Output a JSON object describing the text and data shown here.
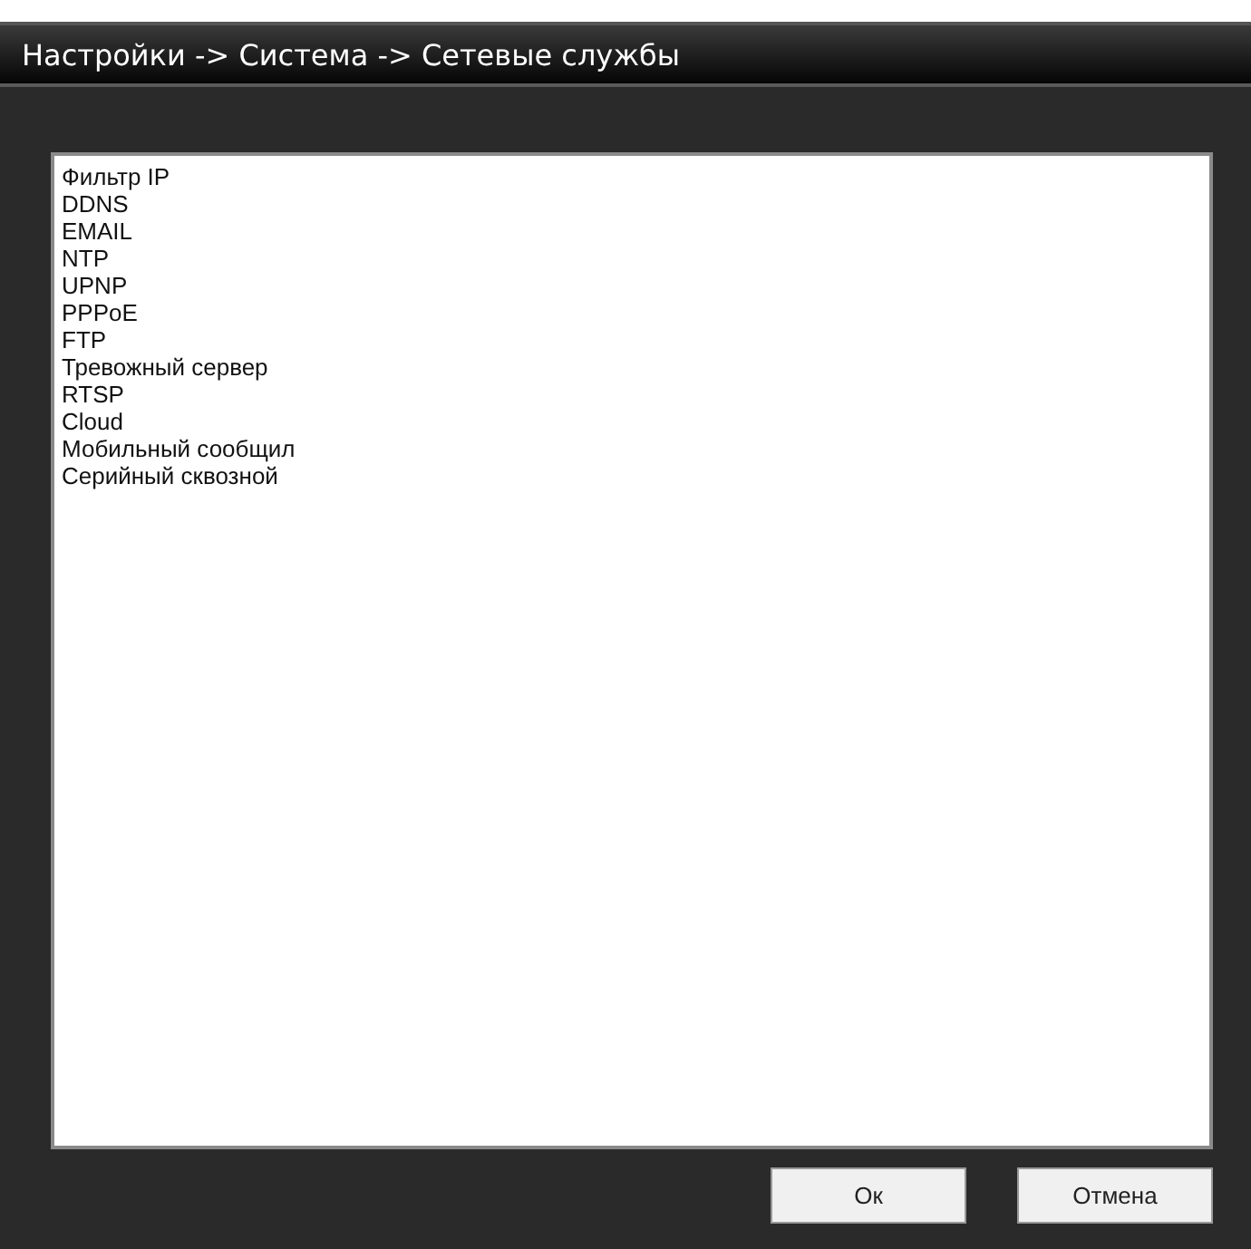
{
  "window": {
    "title": "Настройки -> Система -> Сетевые службы"
  },
  "services": [
    {
      "label": "Фильтр IP"
    },
    {
      "label": "DDNS"
    },
    {
      "label": "EMAIL"
    },
    {
      "label": "NTP"
    },
    {
      "label": "UPNP"
    },
    {
      "label": "PPPoE"
    },
    {
      "label": "FTP"
    },
    {
      "label": "Тревожный сервер"
    },
    {
      "label": "RTSP"
    },
    {
      "label": "Cloud"
    },
    {
      "label": "Мобильный сообщил"
    },
    {
      "label": "Серийный сквозной"
    }
  ],
  "buttons": [
    {
      "label": "Ок"
    },
    {
      "label": "Отмена"
    }
  ]
}
